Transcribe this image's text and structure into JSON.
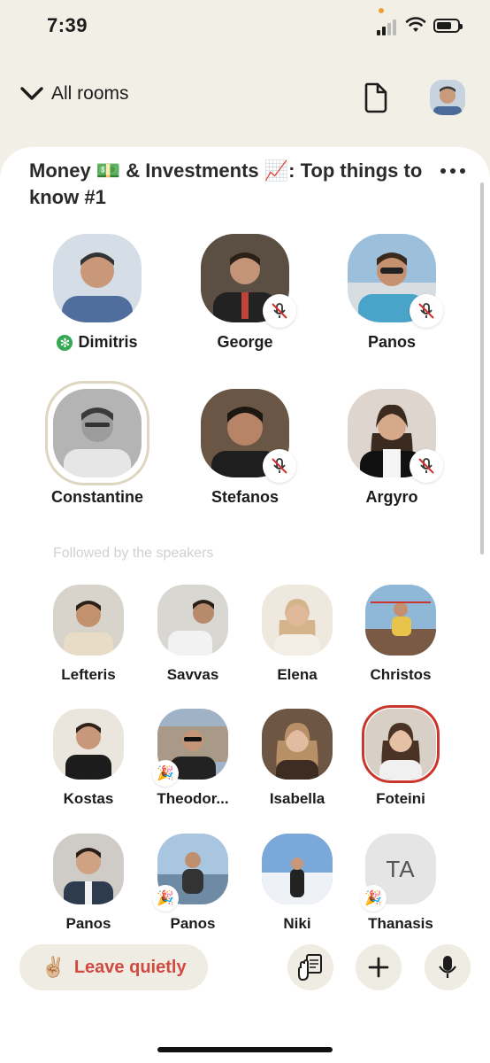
{
  "status_bar": {
    "time": "7:39"
  },
  "nav": {
    "back_label": "All rooms"
  },
  "room": {
    "title": "Money 💵 & Investments 📈: Top things to know  #1"
  },
  "speakers": [
    {
      "name": "Dimitris",
      "moderator": true,
      "muted": false,
      "bg": "#8fa6c4"
    },
    {
      "name": "George",
      "muted": true,
      "bg": "#6b5a4a"
    },
    {
      "name": "Panos",
      "muted": true,
      "bg": "#7fa8c8"
    },
    {
      "name": "Constantine",
      "muted": false,
      "bg": "#9a9a9a"
    },
    {
      "name": "Stefanos",
      "muted": true,
      "bg": "#5a4a3c"
    },
    {
      "name": "Argyro",
      "muted": true,
      "bg": "#c9c0b8"
    }
  ],
  "section_label": "Followed by the speakers",
  "listeners": [
    {
      "name": "Lefteris",
      "bg": "#a89e92"
    },
    {
      "name": "Savvas",
      "bg": "#c4bfb8"
    },
    {
      "name": "Elena",
      "bg": "#d8c8b4"
    },
    {
      "name": "Christos",
      "bg": "#6f8fa6"
    },
    {
      "name": "Kostas",
      "bg": "#8a7a6e"
    },
    {
      "name": "Theodor...",
      "bg": "#8897a6",
      "new": true
    },
    {
      "name": "Isabella",
      "bg": "#9c8676"
    },
    {
      "name": "Foteini",
      "bg": "#cfc2b6",
      "ring": true
    },
    {
      "name": "Panos",
      "bg": "#9a9590"
    },
    {
      "name": "Panos",
      "bg": "#7f93a8",
      "new": true
    },
    {
      "name": "Niki",
      "bg": "#8fb0d0"
    },
    {
      "name": "Thanasis",
      "initials": "TA",
      "new": true
    }
  ],
  "bottom": {
    "leave_label": "Leave quietly",
    "leave_emoji": "✌🏼",
    "new_badge_emoji": "🎉"
  }
}
